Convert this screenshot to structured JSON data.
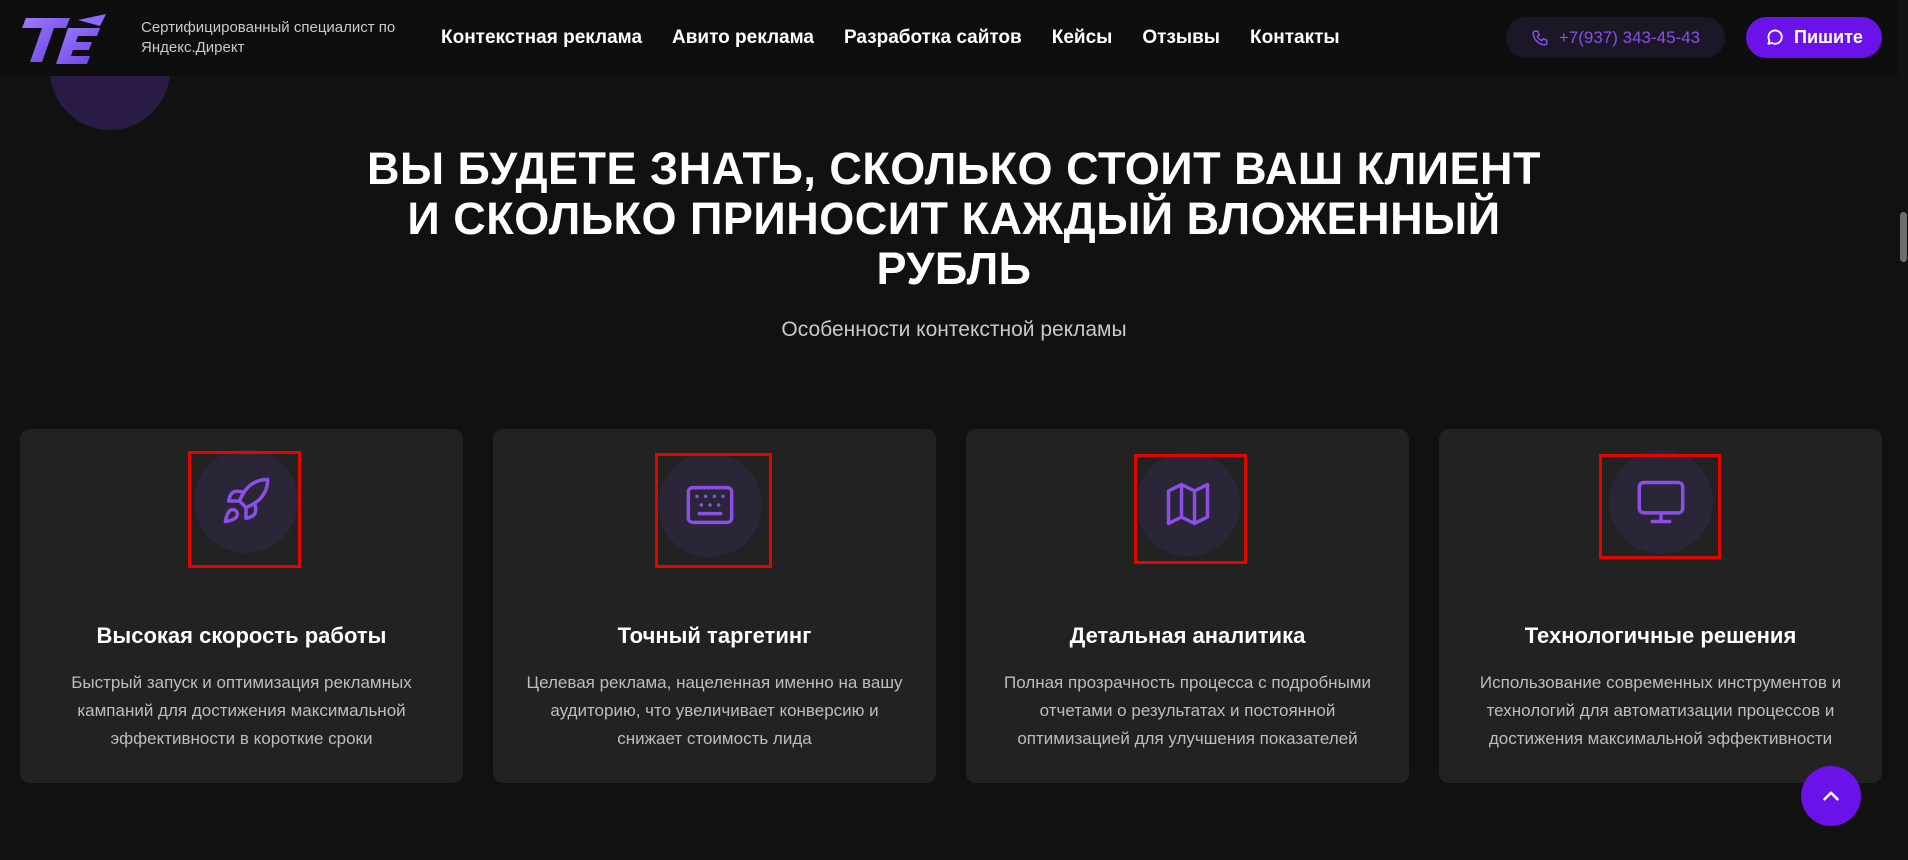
{
  "header": {
    "logo_text": "TE",
    "tagline": "Сертифицированный специалист по Яндекс.Директ",
    "nav": [
      {
        "label": "Контекстная реклама"
      },
      {
        "label": "Авито реклама"
      },
      {
        "label": "Разработка сайтов"
      },
      {
        "label": "Кейсы"
      },
      {
        "label": "Отзывы"
      },
      {
        "label": "Контакты"
      }
    ],
    "phone": "+7(937) 343-45-43",
    "write_label": "Пишите"
  },
  "section": {
    "title_lines": [
      "ВЫ БУДЕТЕ ЗНАТЬ, СКОЛЬКО СТОИТ ВАШ КЛИЕНТ",
      "И СКОЛЬКО ПРИНОСИТ КАЖДЫЙ ВЛОЖЕННЫЙ",
      "РУБЛЬ"
    ],
    "subtitle": "Особенности контекстной рекламы"
  },
  "cards": [
    {
      "icon": "rocket-icon",
      "title": "Высокая скорость работы",
      "desc_lines": [
        "Быстрый запуск и оптимизация рекламных",
        "кампаний для достижения максимальной",
        "эффективности в короткие сроки"
      ]
    },
    {
      "icon": "keyboard-icon",
      "title": "Точный таргетинг",
      "desc_lines": [
        "Целевая реклама, нацеленная именно на вашу",
        "аудиторию, что увеличивает конверсию и",
        "снижает стоимость лида"
      ]
    },
    {
      "icon": "map-icon",
      "title": "Детальная аналитика",
      "desc_lines": [
        "Полная прозрачность процесса с подробными",
        "отчетами о результатах и постоянной",
        "оптимизацией для улучшения показателей"
      ]
    },
    {
      "icon": "monitor-icon",
      "title": "Технологичные решения",
      "desc_lines": [
        "Использование современных инструментов и",
        "технологий для автоматизации процессов и",
        "достижения максимальной эффективности"
      ]
    }
  ],
  "colors": {
    "accent": "#6a12e8",
    "icon": "#8b4ee6",
    "background": "#111111",
    "card": "#222222",
    "highlight_box": "#e10600"
  }
}
